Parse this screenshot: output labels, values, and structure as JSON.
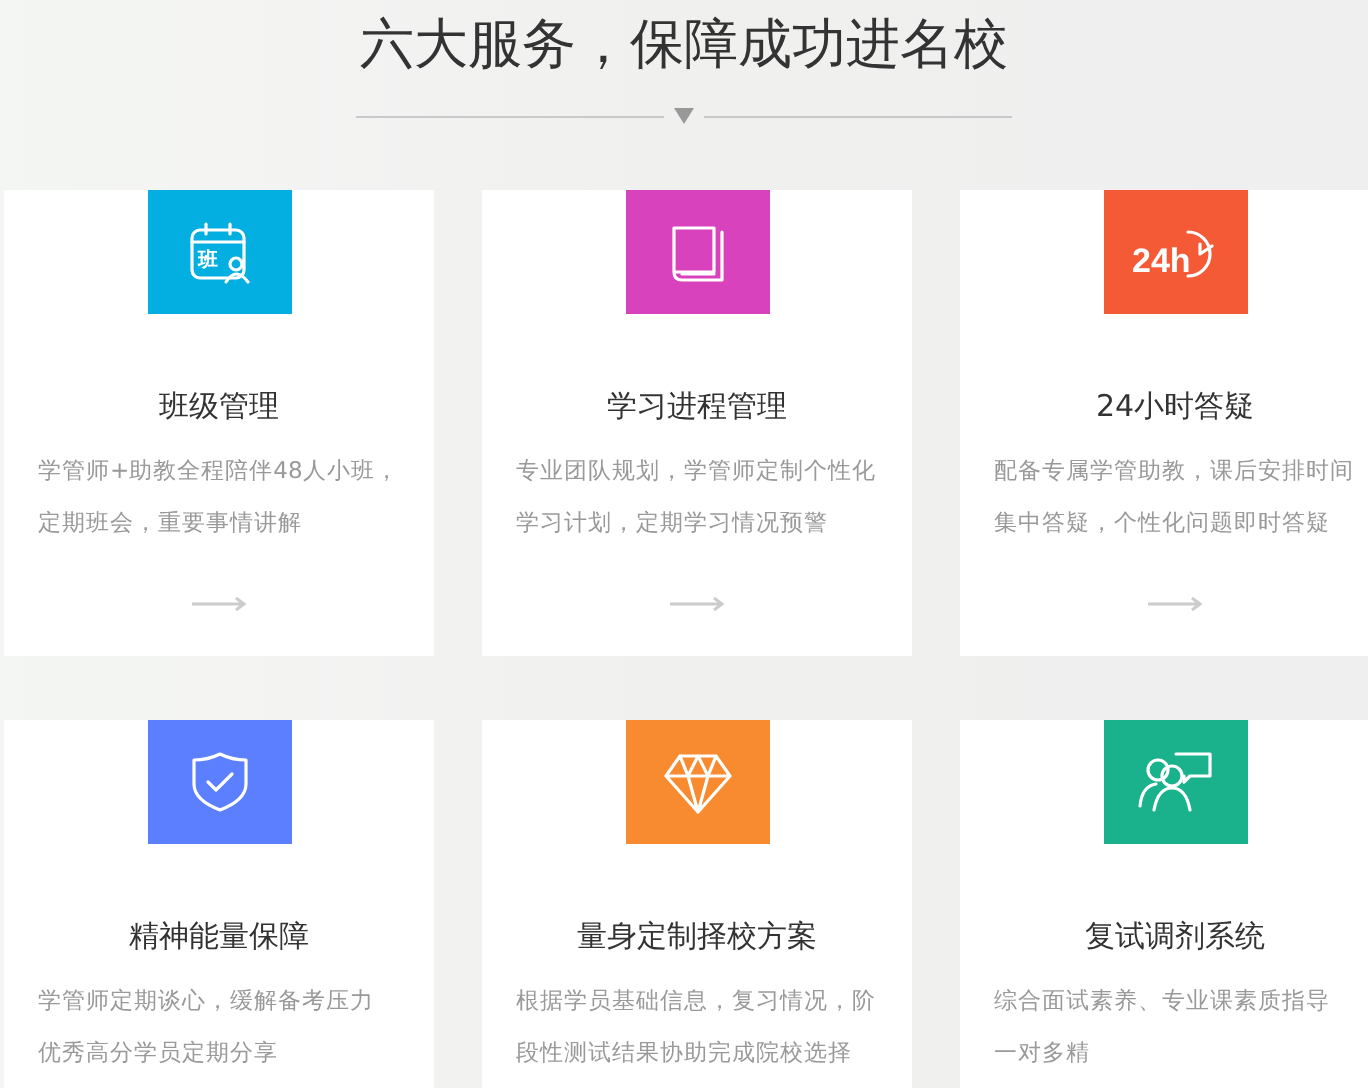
{
  "heading": {
    "title": "六大服务，保障成功进名校"
  },
  "services": [
    {
      "kind": "calendar",
      "icon_text": "班",
      "color": "#03aee0",
      "title": "班级管理",
      "description_lines": [
        "学管师+助教全程陪伴48人小班，",
        "定期班会，重要事情讲解"
      ]
    },
    {
      "kind": "book",
      "color": "#d842bd",
      "title": "学习进程管理",
      "description_lines": [
        "专业团队规划，学管师定制个性化",
        "学习计划，定期学习情况预警"
      ]
    },
    {
      "kind": "clock",
      "icon_text": "24h",
      "color": "#f45a35",
      "title": "24小时答疑",
      "description_lines": [
        "配备专属学管助教，课后安排时间",
        "集中答疑，个性化问题即时答疑"
      ]
    },
    {
      "kind": "shield",
      "color": "#5b7ffe",
      "title": "精神能量保障",
      "description_lines": [
        "学管师定期谈心，缓解备考压力",
        "优秀高分学员定期分享"
      ]
    },
    {
      "kind": "diamond",
      "color": "#f88a30",
      "title": "量身定制择校方案",
      "description_lines": [
        "根据学员基础信息，复习情况，阶",
        "段性测试结果协助完成院校选择"
      ]
    },
    {
      "kind": "people",
      "color": "#19b28c",
      "title": "复试调剂系统",
      "description_lines": [
        "综合面试素养、专业课素质指导",
        "一对多精"
      ]
    }
  ]
}
